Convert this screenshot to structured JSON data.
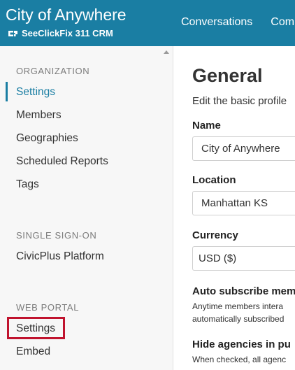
{
  "header": {
    "title": "City of Anywhere",
    "subtitle": "SeeClickFix 311 CRM",
    "logo_icon": "seeclickfix-logo-icon",
    "nav": [
      "Conversations",
      "Com"
    ]
  },
  "sidebar": {
    "sections": [
      {
        "title": "ORGANIZATION",
        "items": [
          "Settings",
          "Members",
          "Geographies",
          "Scheduled Reports",
          "Tags"
        ]
      },
      {
        "title": "SINGLE SIGN-ON",
        "items": [
          "CivicPlus Platform"
        ]
      },
      {
        "title": "WEB PORTAL",
        "items": [
          "Settings",
          "Embed"
        ]
      }
    ],
    "active_item": "Settings"
  },
  "main": {
    "title": "General",
    "description": "Edit the basic profile",
    "fields": {
      "name": {
        "label": "Name",
        "value": "City of Anywhere"
      },
      "location": {
        "label": "Location",
        "value": "Manhattan KS"
      },
      "currency": {
        "label": "Currency",
        "value": "USD ($)"
      }
    },
    "options": {
      "auto_subscribe": {
        "title": "Auto subscribe mem",
        "desc_line1": "Anytime members intera",
        "desc_line2": "automatically subscribed"
      },
      "hide_agencies": {
        "title": "Hide agencies in pu",
        "desc_line1": "When checked, all agenc"
      }
    }
  },
  "colors": {
    "brand": "#1a7ea3",
    "highlight": "#c0132e"
  }
}
